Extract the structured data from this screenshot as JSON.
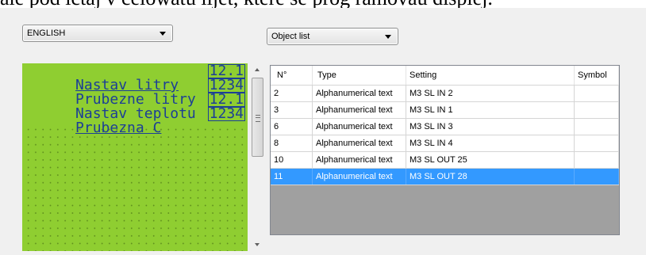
{
  "top_text": "ale pod íctaj v celowatu lijet, které se prog ramovau displej.",
  "language_select": {
    "value": "ENGLISH"
  },
  "object_select": {
    "value": "Object list"
  },
  "lcd": {
    "lines": [
      {
        "label": "Nastav litry",
        "value": "12.1"
      },
      {
        "label": "Prubezne litry",
        "value": "1234"
      },
      {
        "label": "Nastav teplotu",
        "value": "12.1"
      },
      {
        "label": "Prubezna C",
        "value": "1234"
      }
    ]
  },
  "object_table": {
    "columns": [
      "N°",
      "Type",
      "Setting",
      "Symbol"
    ],
    "rows": [
      {
        "no": "2",
        "type": "Alphanumerical text",
        "setting": "M3 SL IN 2",
        "symbol": ""
      },
      {
        "no": "3",
        "type": "Alphanumerical text",
        "setting": "M3 SL IN 1",
        "symbol": ""
      },
      {
        "no": "6",
        "type": "Alphanumerical text",
        "setting": "M3 SL IN 3",
        "symbol": ""
      },
      {
        "no": "8",
        "type": "Alphanumerical text",
        "setting": "M3 SL IN 4",
        "symbol": ""
      },
      {
        "no": "10",
        "type": "Alphanumerical text",
        "setting": "M3 SL OUT 25",
        "symbol": ""
      },
      {
        "no": "11",
        "type": "Alphanumerical text",
        "setting": "M3 SL OUT 28",
        "symbol": ""
      }
    ],
    "selected_row_index": 5
  },
  "colors": {
    "lcd_background": "#8fce31",
    "lcd_text": "#1c3f96",
    "selection": "#3399ff"
  },
  "icons": [
    "dropdown-arrow-icon",
    "scroll-up-arrow-icon",
    "scroll-down-arrow-icon",
    "scroll-grip-icon"
  ]
}
